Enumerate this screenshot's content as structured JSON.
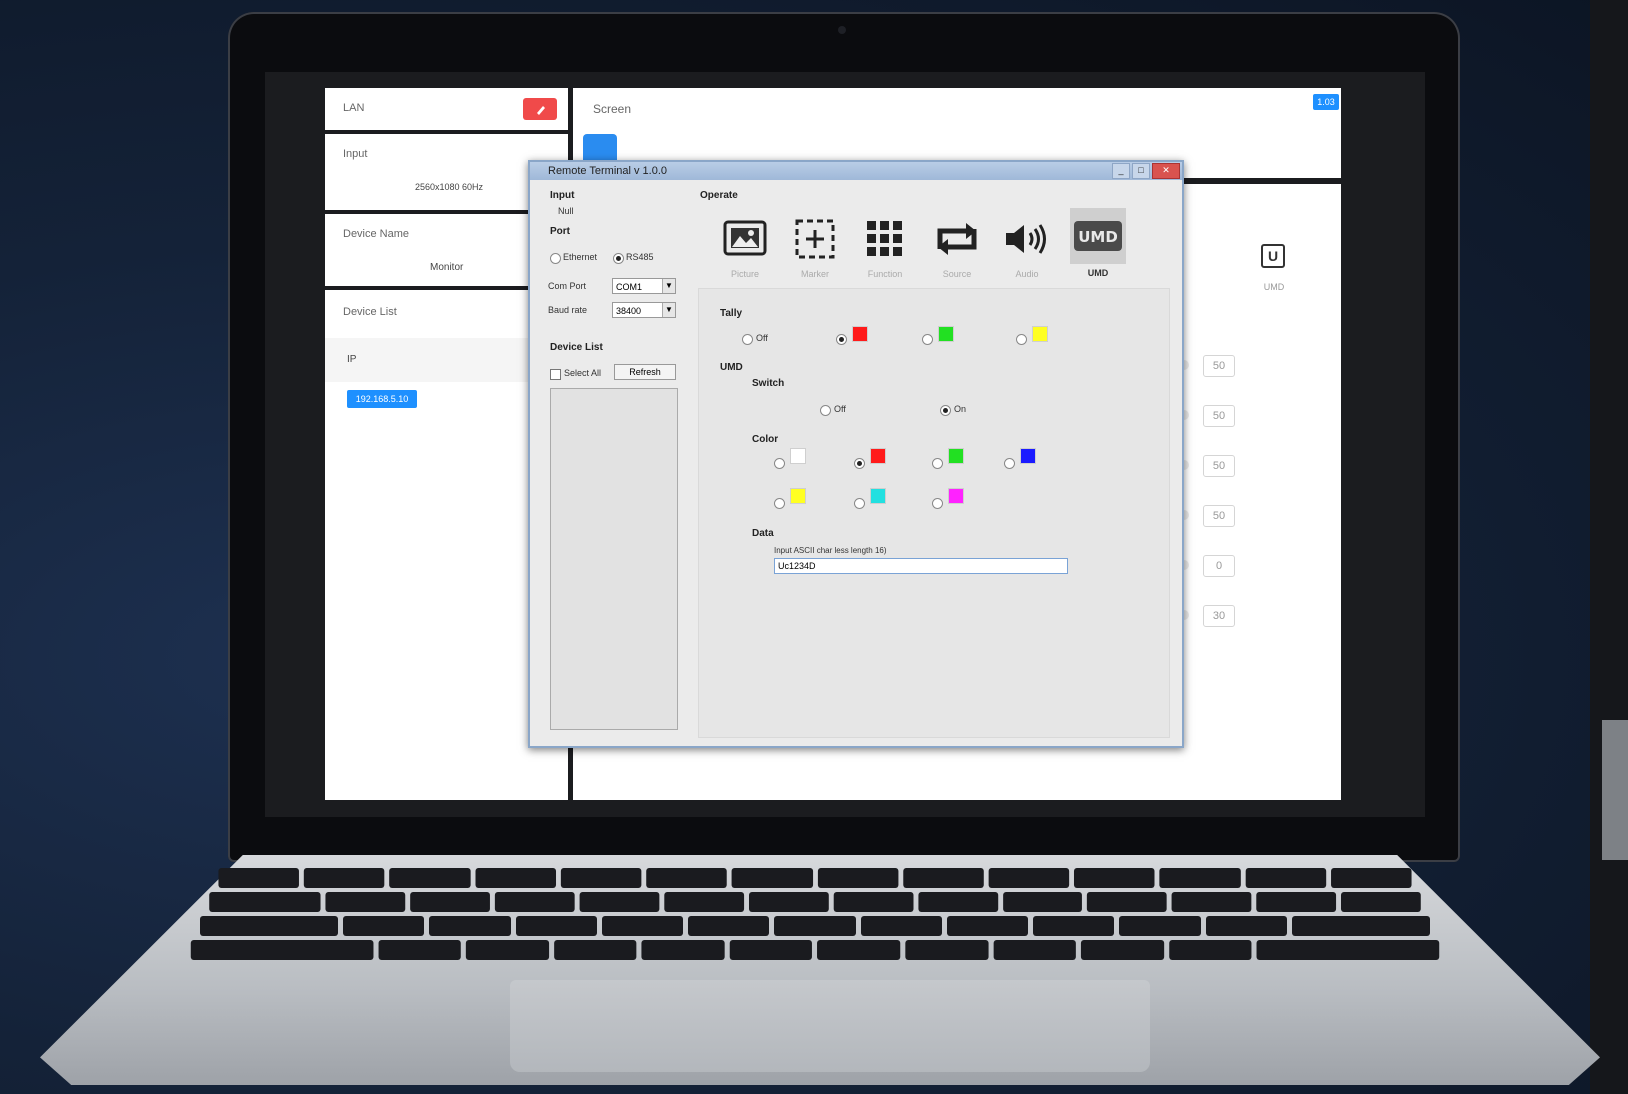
{
  "app": {
    "lan_label": "LAN",
    "screen_label": "Screen",
    "version_badge": "1.03",
    "input_label": "Input",
    "input_value": "2560x1080 60Hz",
    "device_name_label": "Device Name",
    "device_name_value": "Monitor",
    "device_list_label": "Device List",
    "ip_label": "IP",
    "ip_chip": "192.168.5.10",
    "umd_label": "UMD",
    "right_values": [
      "50",
      "50",
      "50",
      "50",
      "0",
      "30"
    ]
  },
  "dialog": {
    "title": "Remote Terminal v 1.0.0",
    "input_section": "Input",
    "input_value": "Null",
    "port_section": "Port",
    "port_options": [
      "Ethernet",
      "RS485"
    ],
    "com_row_label": "Com Port",
    "com_value": "COM1",
    "baud_row_label": "Baud rate",
    "baud_value": "38400",
    "device_list_section": "Device List",
    "select_all_label": "Select All",
    "refresh_label": "Refresh",
    "operate_section": "Operate",
    "operate_icons": [
      {
        "name": "picture-icon",
        "label": "Picture"
      },
      {
        "name": "marker-icon",
        "label": "Marker"
      },
      {
        "name": "function-icon",
        "label": "Function"
      },
      {
        "name": "source-icon",
        "label": "Source"
      },
      {
        "name": "audio-icon",
        "label": "Audio"
      },
      {
        "name": "umd-icon",
        "label": "UMD"
      }
    ],
    "tally_section": "Tally",
    "tally_off": "Off",
    "umd_section": "UMD",
    "switch_section": "Switch",
    "switch_off": "Off",
    "switch_on": "On",
    "color_section": "Color",
    "data_section": "Data",
    "data_hint": "Input ASCII char less length 16)",
    "data_value": "Uc1234D"
  },
  "colors": {
    "red": "#ff1a1a",
    "green": "#22e022",
    "yellow": "#ffff22",
    "white": "#ffffff",
    "blue": "#1a1aff",
    "cyan": "#22e0e0",
    "magenta": "#ff22ff",
    "accent": "#1e90ff"
  }
}
